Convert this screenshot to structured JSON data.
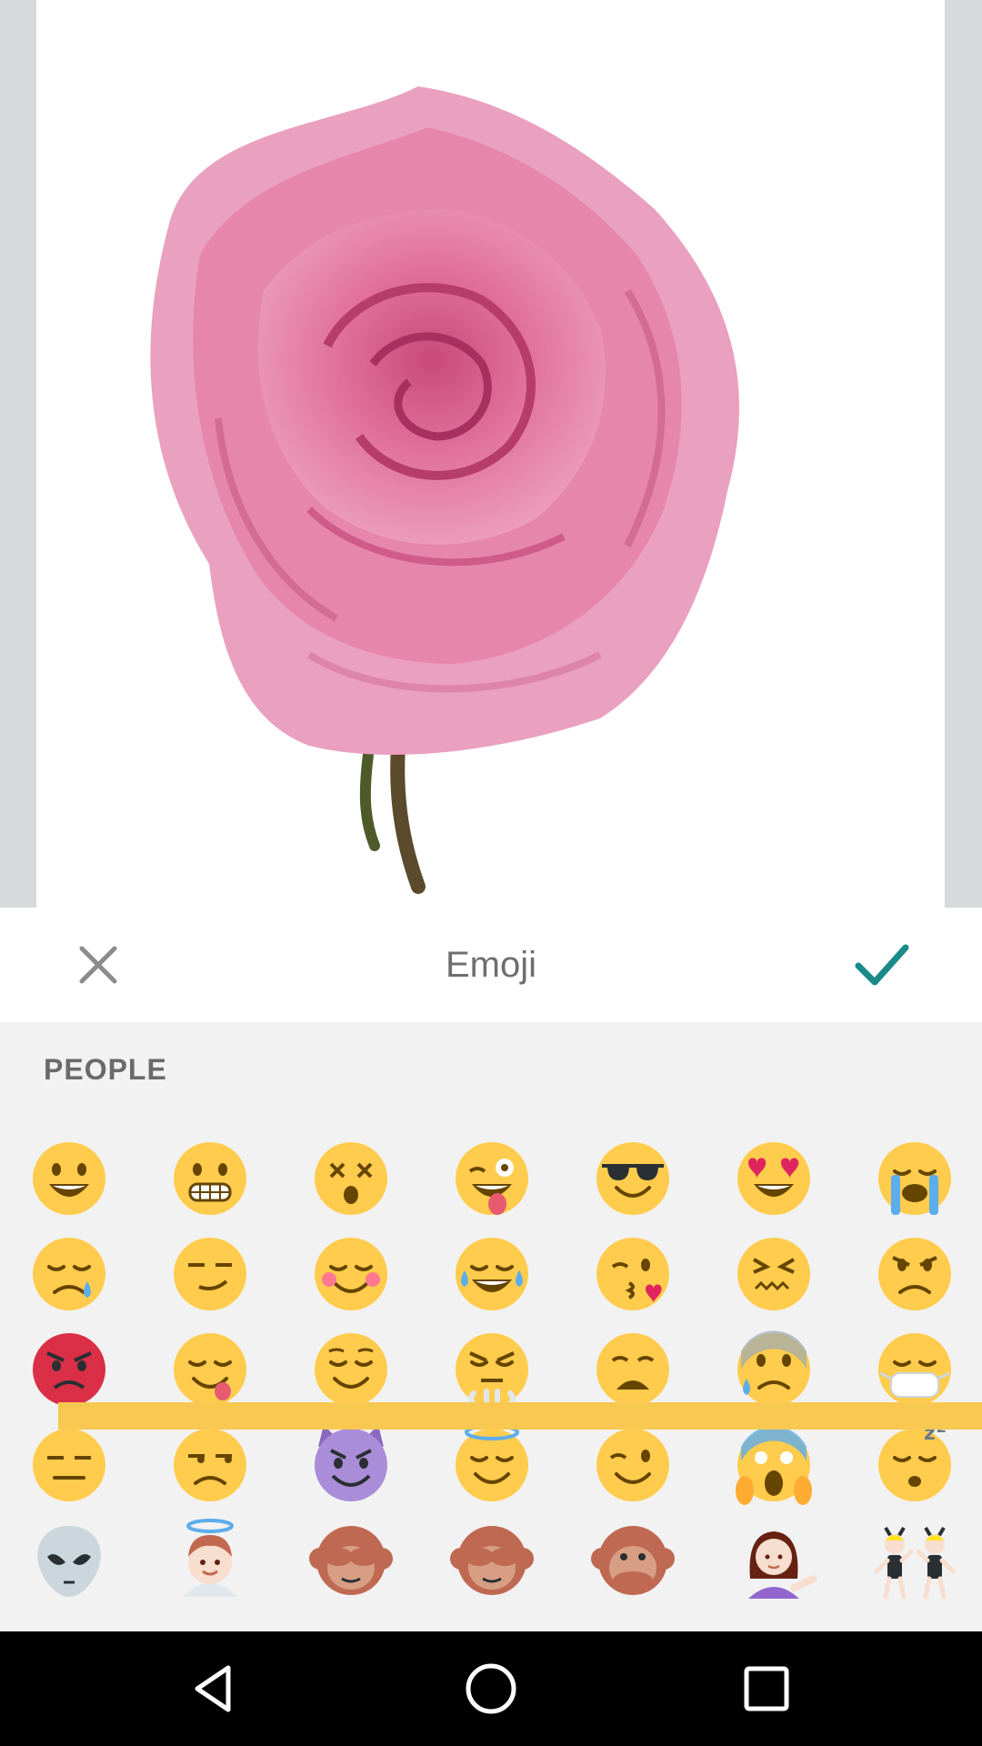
{
  "photo": {
    "subject_icon": "pink-rose-image"
  },
  "header": {
    "title": "Emoji",
    "close_icon": "close-icon",
    "confirm_icon": "check-icon",
    "confirm_color": "#1a8a8a"
  },
  "panel": {
    "section_label": "PEOPLE",
    "slider_color": "#f8c850",
    "rows": [
      [
        "smiley-icon",
        "grimacing-icon",
        "dizzy-face-icon",
        "winking-tongue-icon",
        "sunglasses-icon",
        "heart-eyes-icon",
        "loudly-crying-icon"
      ],
      [
        "sleepy-icon",
        "smirk-icon",
        "blush-icon",
        "tears-of-joy-icon",
        "kissing-heart-icon",
        "confounded-icon",
        "angry-icon"
      ],
      [
        "pouting-icon",
        "yum-icon",
        "relieved-icon",
        "triumph-icon",
        "weary-icon",
        "cold-sweat-icon",
        "mask-icon"
      ],
      [
        "expressionless-icon",
        "unamused-icon",
        "smiling-imp-icon",
        "innocent-icon",
        "wink-icon",
        "scream-icon",
        "sleeping-icon"
      ],
      [
        "alien-icon",
        "angel-icon",
        "see-no-evil-monkey-icon",
        "hear-no-evil-monkey-icon",
        "speak-no-evil-monkey-icon",
        "information-desk-person-icon",
        "dancers-icon"
      ]
    ]
  },
  "navbar": {
    "back_icon": "back-triangle-icon",
    "home_icon": "home-circle-icon",
    "recents_icon": "recents-square-icon"
  }
}
